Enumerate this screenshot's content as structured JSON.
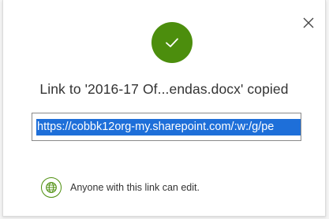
{
  "dialog": {
    "title": "Link to '2016-17 Of...endas.docx' copied",
    "link_value": "https://cobbk12org-my.sharepoint.com/:w:/g/pe",
    "permission_text": "Anyone with this link can edit.",
    "icons": {
      "close": "close-icon",
      "success": "checkmark-icon",
      "permission": "globe-icon"
    },
    "colors": {
      "success_green": "#4c8e0d",
      "selection_blue": "#1e6fd9",
      "text": "#333333"
    }
  }
}
